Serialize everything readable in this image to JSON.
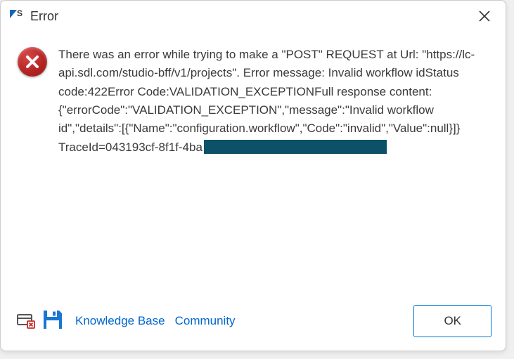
{
  "titlebar": {
    "title": "Error"
  },
  "message": {
    "text_before_redact": "There was an error while trying to make a \"POST\" REQUEST at Url: \"https://lc-api.sdl.com/studio-bff/v1/projects\". Error message: Invalid workflow idStatus code:422Error Code:VALIDATION_EXCEPTIONFull response content:{\"errorCode\":\"VALIDATION_EXCEPTION\",\"message\":\"Invalid workflow id\",\"details\":[{\"Name\":\"configuration.workflow\",\"Code\":\"invalid\",\"Value\":null}]} TraceId=043193cf-8f1f-4ba"
  },
  "footer": {
    "knowledge_base_label": "Knowledge Base",
    "community_label": "Community",
    "ok_label": "OK"
  }
}
